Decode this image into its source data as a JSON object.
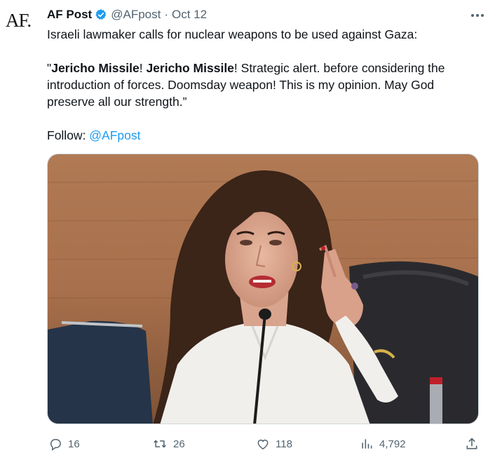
{
  "tweet": {
    "avatar_text": "AF.",
    "author_name": "AF Post",
    "handle": "@AFpost",
    "separator": "·",
    "date": "Oct 12",
    "line1": "Israeli lawmaker calls for nuclear weapons to be used against Gaza:",
    "quote_open": "\"",
    "bold1": "Jericho Missile",
    "mid1": "! ",
    "bold2": "Jericho Missile",
    "quote_rest": "! Strategic alert. before considering the introduction of forces. Doomsday weapon! This is my opinion. May God preserve all our strength.”",
    "follow_label": "Follow: ",
    "follow_link": "@AFpost"
  },
  "actions": {
    "replies": "16",
    "retweets": "26",
    "likes": "118",
    "views": "4,792"
  },
  "colors": {
    "accent": "#1d9bf0",
    "muted": "#536471",
    "text": "#0f1419"
  },
  "icons": [
    "verified-badge-icon",
    "more-icon",
    "reply-icon",
    "retweet-icon",
    "like-icon",
    "views-icon",
    "share-icon"
  ]
}
